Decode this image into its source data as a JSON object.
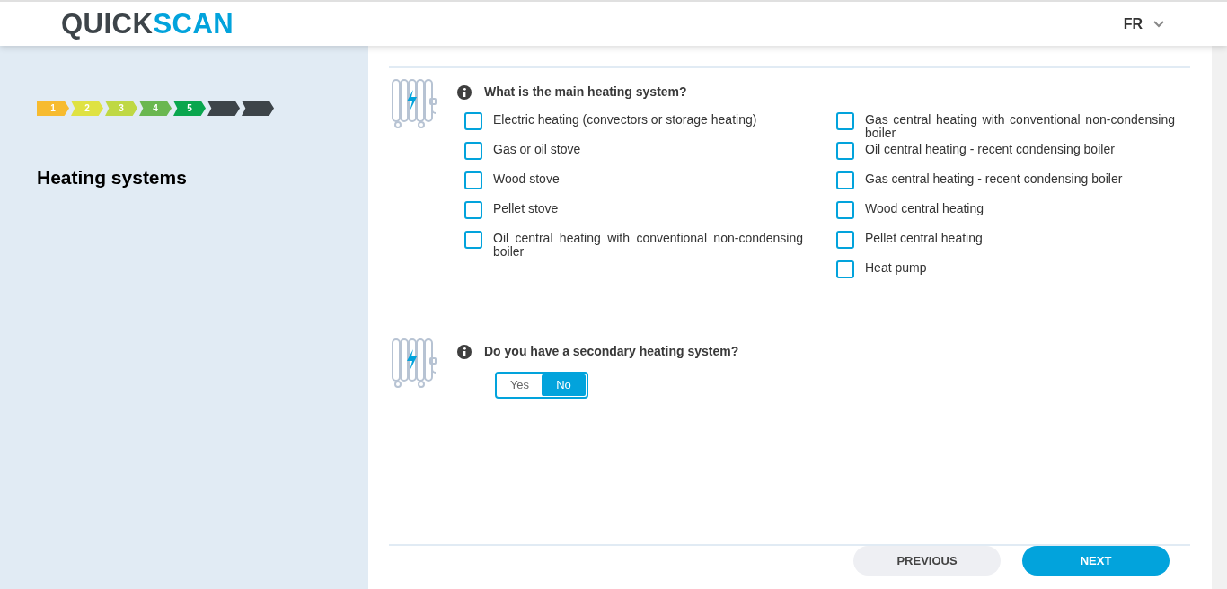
{
  "header": {
    "logo": {
      "part_1": "QUICK",
      "part_2": "SCAN"
    },
    "language": "FR"
  },
  "sidebar": {
    "steps": [
      {
        "label": "1",
        "color": "#f7bb2f"
      },
      {
        "label": "2",
        "color": "#dfe243"
      },
      {
        "label": "3",
        "color": "#bfd844"
      },
      {
        "label": "4",
        "color": "#6ab750"
      },
      {
        "label": "5",
        "color": "#0aa64e"
      },
      {
        "color": "#3d4449"
      },
      {
        "color": "#3d4449"
      }
    ],
    "title": "Heating systems"
  },
  "questions": [
    {
      "kind": "checklist",
      "question": "What is the main heating system?",
      "columns": [
        [
          {
            "label": "Electric heating (convectors or storage heating)",
            "checked": false
          },
          {
            "label": "Gas or oil stove",
            "checked": false
          },
          {
            "label": "Wood stove",
            "checked": false
          },
          {
            "label": "Pellet stove",
            "checked": false
          },
          {
            "label": "Oil central heating with conventional non-condensing boiler",
            "checked": false
          }
        ],
        [
          {
            "label": "Gas central heating with conventional non-condensing boiler",
            "checked": false
          },
          {
            "label": "Oil central heating - recent condensing boiler",
            "checked": false
          },
          {
            "label": "Gas central heating - recent condensing boiler",
            "checked": false
          },
          {
            "label": "Wood central heating",
            "checked": false
          },
          {
            "label": "Pellet central heating",
            "checked": false
          },
          {
            "label": "Heat pump",
            "checked": false
          }
        ]
      ]
    },
    {
      "kind": "toggle",
      "question": "Do you have a secondary heating system?",
      "options": [
        {
          "label": "Yes",
          "selected": false
        },
        {
          "label": "No",
          "selected": true
        }
      ]
    }
  ],
  "footer": {
    "previous": "PREVIOUS",
    "next": "NEXT"
  }
}
